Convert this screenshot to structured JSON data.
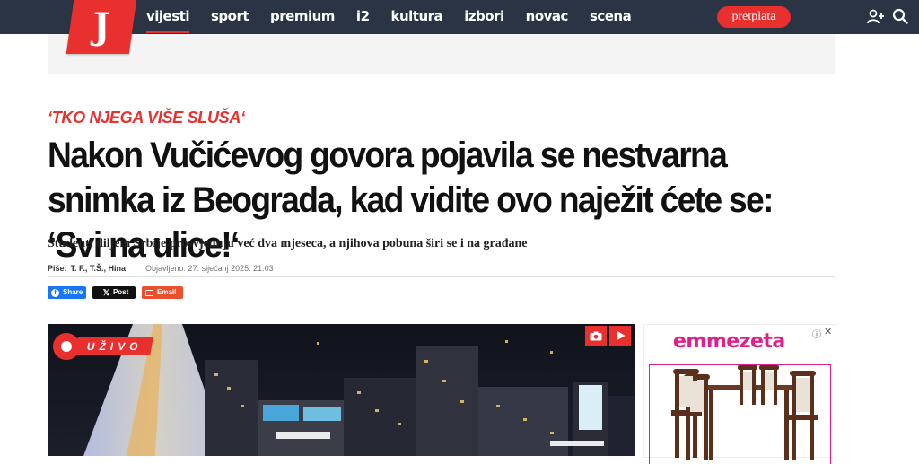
{
  "brand": {
    "logo_letter": "J"
  },
  "nav": {
    "items": [
      {
        "label": "vijesti",
        "active": true
      },
      {
        "label": "sport"
      },
      {
        "label": "premium"
      },
      {
        "label": "i2"
      },
      {
        "label": "kultura"
      },
      {
        "label": "izbori"
      },
      {
        "label": "novac"
      },
      {
        "label": "scena"
      }
    ],
    "subscribe_label": "pretplata",
    "icons": [
      "add-user-icon",
      "search-icon"
    ]
  },
  "article": {
    "kicker": "‘TKO NJEGA VIŠE SLUŠA‘",
    "headline": "Nakon Vučićevog govora pojavila se nestvarna snimka iz Beograda, kad vidite ovo naježit ćete se: ‘Svi na ulice!‘",
    "lead": "Studenti diljem Srbije prosvjeduju već dva mjeseca, a njihova pobuna širi se i na građane",
    "author_label": "Piše:",
    "author": "T. F., T.Š., Hina",
    "published": "Objavljeno: 27. siječanj 2025. 21:03"
  },
  "share": {
    "facebook": "Share",
    "x": "Post",
    "email": "Email"
  },
  "video": {
    "live_label": "UŽIVO",
    "icons": [
      "camera-icon",
      "play-icon"
    ]
  },
  "ad": {
    "brand": "emmezeta",
    "colors": {
      "brand": "#e0208a"
    }
  },
  "colors": {
    "accent": "#e8312f",
    "nav_bg": "#2b3445",
    "facebook": "#1877f2"
  }
}
